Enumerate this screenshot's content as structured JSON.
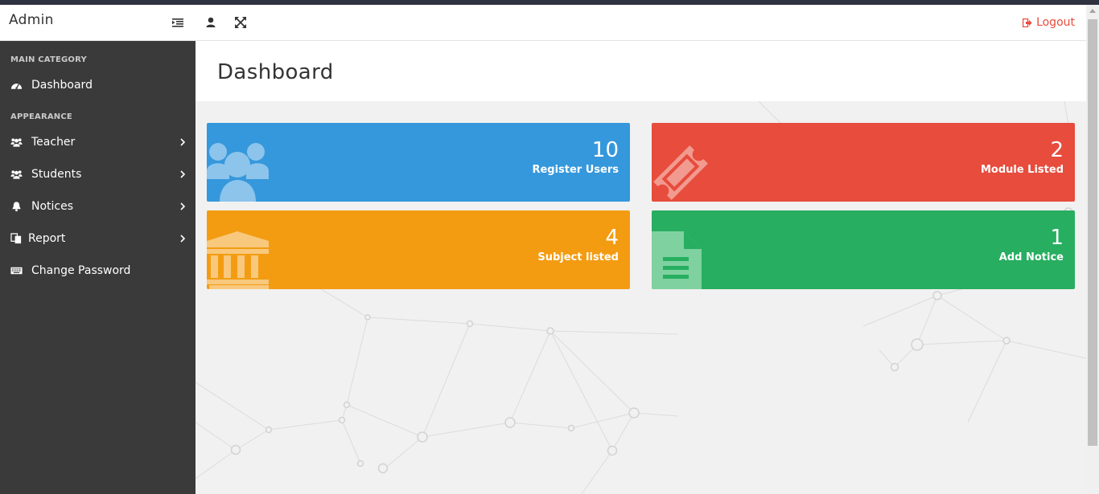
{
  "app": {
    "brand": "Admin"
  },
  "topbar": {
    "icons": [
      "list-indent-icon",
      "user-icon",
      "expand-icon"
    ],
    "logout_label": "Logout"
  },
  "sidebar": {
    "categories": {
      "main": "MAIN CATEGORY",
      "appearance": "APPEARANCE"
    },
    "items": [
      {
        "label": "Dashboard",
        "icon": "dashboard-icon",
        "has_submenu": false
      },
      {
        "label": "Teacher",
        "icon": "users-icon",
        "has_submenu": true
      },
      {
        "label": "Students",
        "icon": "users-icon",
        "has_submenu": true
      },
      {
        "label": "Notices",
        "icon": "bell-icon",
        "has_submenu": true
      },
      {
        "label": "Report",
        "icon": "copy-icon",
        "has_submenu": true
      },
      {
        "label": "Change Password",
        "icon": "keyboard-icon",
        "has_submenu": false
      }
    ]
  },
  "page": {
    "title": "Dashboard"
  },
  "cards": [
    {
      "value": "10",
      "label": "Register Users",
      "icon": "users-icon",
      "color": "#3598dc"
    },
    {
      "value": "2",
      "label": "Module Listed",
      "icon": "ticket-icon",
      "color": "#e74c3c"
    },
    {
      "value": "4",
      "label": "Subject listed",
      "icon": "institution-icon",
      "color": "#f39c12"
    },
    {
      "value": "1",
      "label": "Add Notice",
      "icon": "file-text-icon",
      "color": "#27ae60"
    }
  ],
  "colors": {
    "sidebar": "#3a3a3a",
    "logout": "#e74c3c",
    "background": "#f1f1f1"
  }
}
